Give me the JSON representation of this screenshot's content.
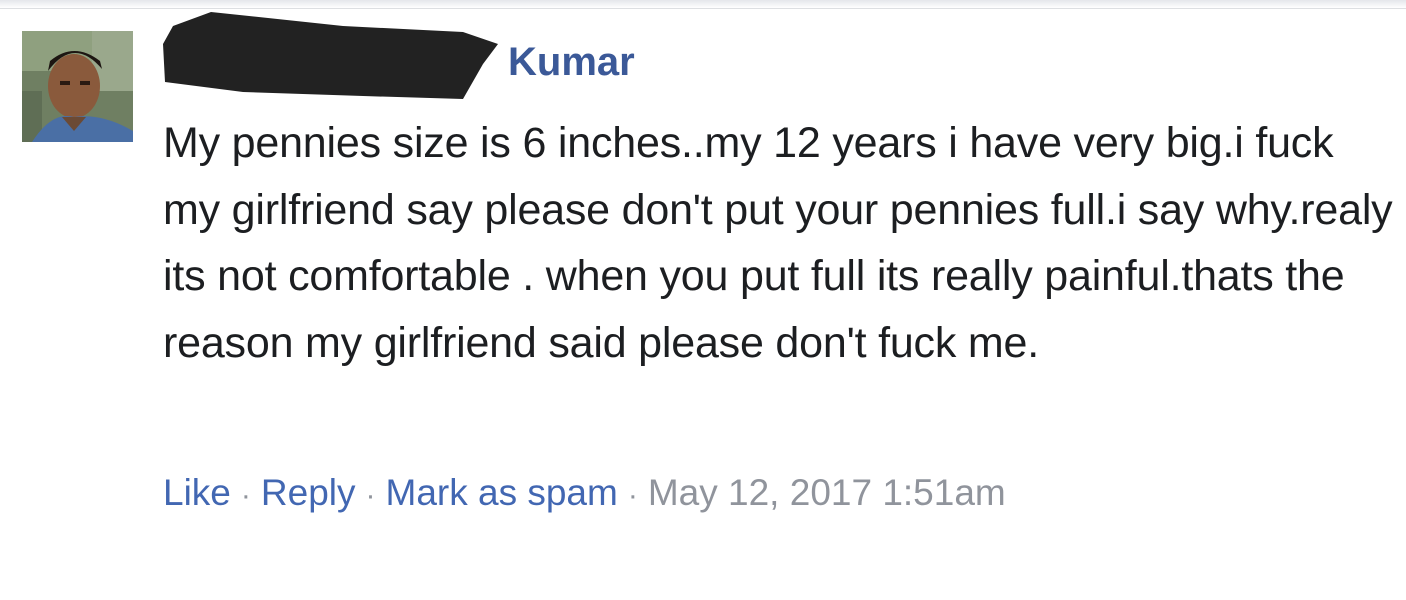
{
  "comment": {
    "author": {
      "name_visible": "Kumar",
      "avatar_icon": "user-avatar"
    },
    "text": "My pennies size is 6 inches..my 12 years i have very big.i fuck my girlfriend say please don't put your pennies full.i say why.realy its not comfortable . when you put full its really painful.thats the reason my girlfriend said please don't fuck me.",
    "actions": {
      "like_label": "Like",
      "reply_label": "Reply",
      "spam_label": "Mark as spam",
      "separator": "·",
      "timestamp": "May 12, 2017 1:51am"
    }
  },
  "colors": {
    "link": "#4267b2",
    "author": "#3b5998",
    "text": "#1c1e21",
    "muted": "#90949c"
  }
}
